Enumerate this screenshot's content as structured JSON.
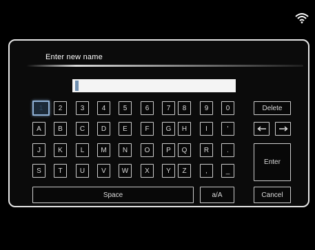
{
  "dialog": {
    "title": "Enter new name",
    "name_value": ""
  },
  "keyboard": {
    "row1": [
      "1",
      "2",
      "3",
      "4",
      "5",
      "6",
      "7",
      "8",
      "9",
      "0"
    ],
    "row2": [
      "A",
      "B",
      "C",
      "D",
      "E",
      "F",
      "G",
      "H",
      "I",
      "'"
    ],
    "row3": [
      "J",
      "K",
      "L",
      "M",
      "N",
      "O",
      "P",
      "Q",
      "R",
      "."
    ],
    "row4": [
      "S",
      "T",
      "U",
      "V",
      "W",
      "X",
      "Y",
      "Z",
      ",",
      "_"
    ],
    "space_label": "Space",
    "case_label": "a/A",
    "delete_label": "Delete",
    "enter_label": "Enter",
    "cancel_label": "Cancel",
    "focused_key": "1"
  },
  "icons": {
    "status": "wifi-icon",
    "left": "arrow-left-icon",
    "right": "arrow-right-icon"
  },
  "colors": {
    "focus": "#8fb1d6",
    "border": "#cfcfcf",
    "background": "#000000"
  }
}
